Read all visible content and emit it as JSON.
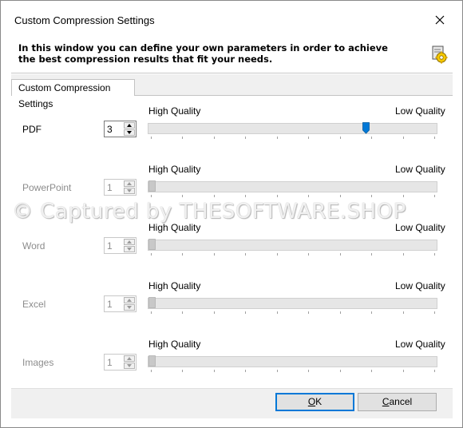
{
  "window": {
    "title": "Custom Compression Settings",
    "close_icon": "close-icon"
  },
  "header": {
    "line1": "In this window you can define your own parameters in order to achieve",
    "line2": "the best compression results that fit your needs.",
    "icon": "settings-gear-icon"
  },
  "tab": {
    "label": "Custom Compression Settings"
  },
  "rows": [
    {
      "label": "PDF",
      "value": "3",
      "enabled": true,
      "slider_fraction": 0.76,
      "high_label": "High Quality",
      "low_label": "Low Quality"
    },
    {
      "label": "PowerPoint",
      "value": "1",
      "enabled": false,
      "slider_fraction": 0.0,
      "high_label": "High Quality",
      "low_label": "Low Quality"
    },
    {
      "label": "Word",
      "value": "1",
      "enabled": false,
      "slider_fraction": 0.0,
      "high_label": "High Quality",
      "low_label": "Low Quality"
    },
    {
      "label": "Excel",
      "value": "1",
      "enabled": false,
      "slider_fraction": 0.0,
      "high_label": "High Quality",
      "low_label": "Low Quality"
    },
    {
      "label": "Images",
      "value": "1",
      "enabled": false,
      "slider_fraction": 0.0,
      "high_label": "High Quality",
      "low_label": "Low Quality"
    }
  ],
  "buttons": {
    "ok_underlined": "O",
    "ok_rest": "K",
    "cancel_underlined": "C",
    "cancel_rest": "ancel"
  },
  "colors": {
    "accent": "#0078d7",
    "disabled_text": "#8c8c8c",
    "disabled_thumb": "#c8c8c8"
  },
  "watermark": "© Captured by THESOFTWARE.SHOP"
}
